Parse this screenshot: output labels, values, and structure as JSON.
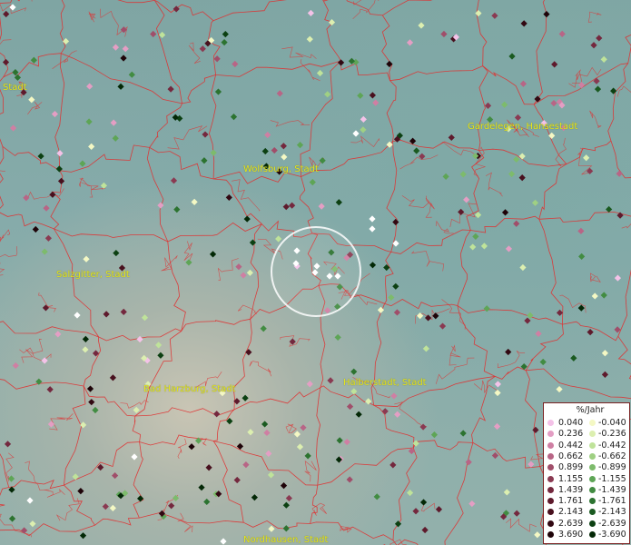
{
  "cities": [
    {
      "name": "Stadt"
    },
    {
      "name": "Wolfsburg, Stadt"
    },
    {
      "name": "Gardelegen, Hansestadt"
    },
    {
      "name": "Salzgitter, Stadt"
    },
    {
      "name": "Bad Harzburg, Stadt"
    },
    {
      "name": "Halberstadt, Stadt"
    },
    {
      "name": "Nordhausen, Stadt"
    }
  ],
  "legend": {
    "title": "%/Jahr",
    "positive": [
      {
        "label": "0.040",
        "color": "#f4c2e8"
      },
      {
        "label": "0.236",
        "color": "#e49ec4"
      },
      {
        "label": "0.442",
        "color": "#cf7fa3"
      },
      {
        "label": "0.662",
        "color": "#b86586"
      },
      {
        "label": "0.899",
        "color": "#a04e6a"
      },
      {
        "label": "1.155",
        "color": "#8a3a52"
      },
      {
        "label": "1.439",
        "color": "#74283e"
      },
      {
        "label": "1.761",
        "color": "#5e1a2c"
      },
      {
        "label": "2.143",
        "color": "#48101e"
      },
      {
        "label": "2.639",
        "color": "#320812"
      },
      {
        "label": "3.690",
        "color": "#1e0308"
      }
    ],
    "negative": [
      {
        "label": "-0.040",
        "color": "#f4f8c4"
      },
      {
        "label": "-0.236",
        "color": "#dcefb0"
      },
      {
        "label": "-0.442",
        "color": "#bfe39a"
      },
      {
        "label": "-0.662",
        "color": "#9fd083"
      },
      {
        "label": "-0.899",
        "color": "#7dbb6c"
      },
      {
        "label": "-1.155",
        "color": "#5ea556"
      },
      {
        "label": "-1.439",
        "color": "#428c42"
      },
      {
        "label": "-1.761",
        "color": "#2c7330"
      },
      {
        "label": "-2.143",
        "color": "#1a5a20"
      },
      {
        "label": "-2.639",
        "color": "#0c4012"
      },
      {
        "label": "-3.690",
        "color": "#032806"
      }
    ]
  }
}
